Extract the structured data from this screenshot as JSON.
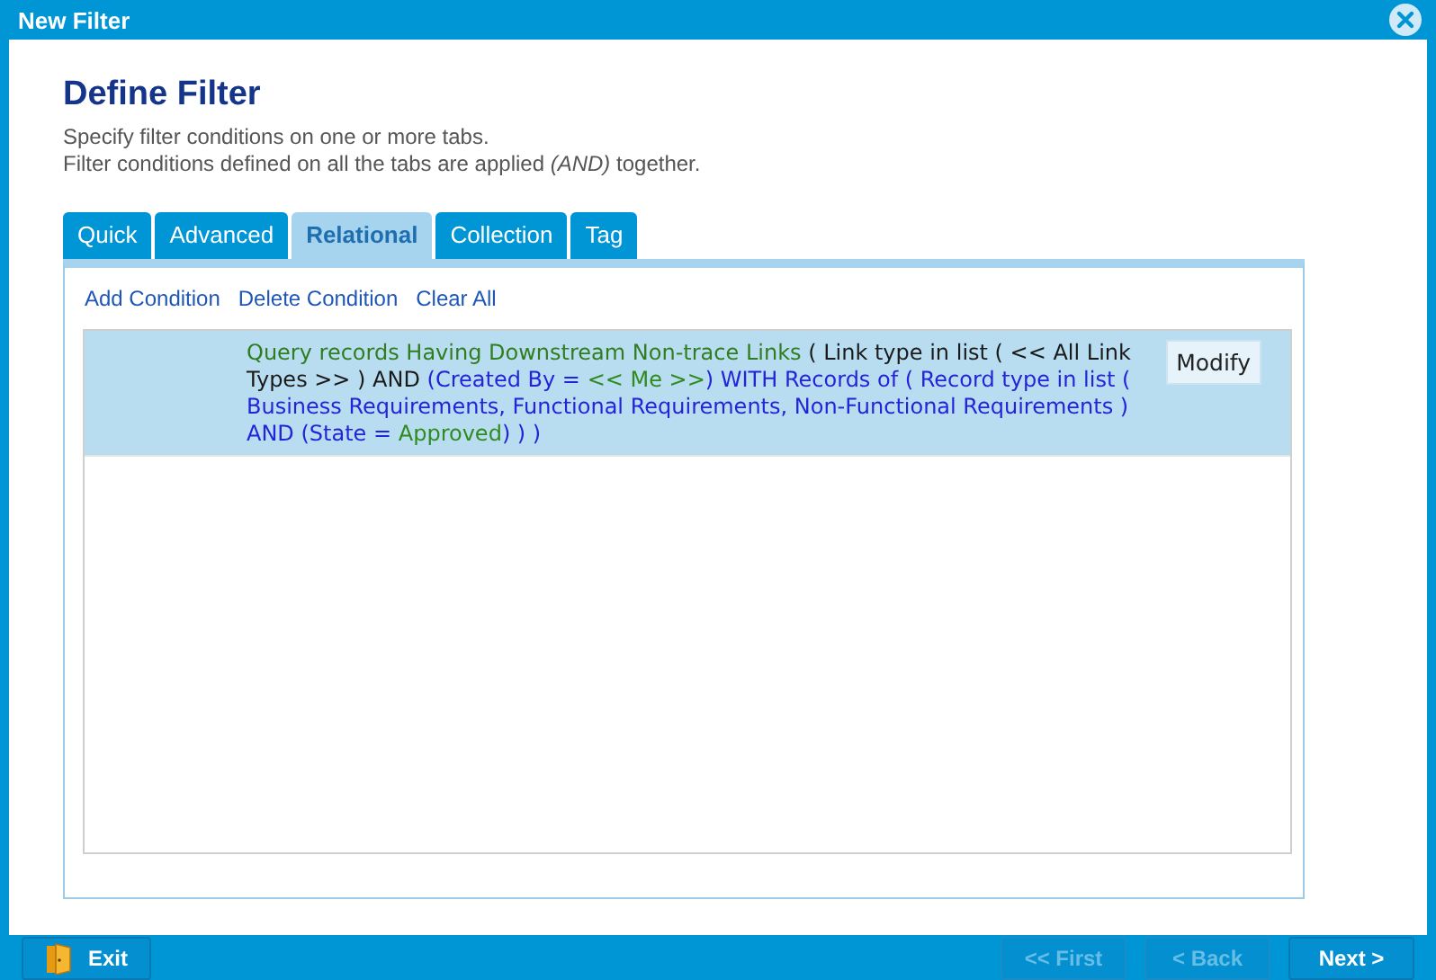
{
  "window": {
    "title": "New Filter"
  },
  "heading": "Define Filter",
  "description": [
    "Specify filter conditions on one or more tabs.",
    "Filter conditions defined on all the tabs are applied *(AND)* together."
  ],
  "tabs": [
    {
      "label": "Quick",
      "selected": false
    },
    {
      "label": "Advanced",
      "selected": false
    },
    {
      "label": "Relational",
      "selected": true
    },
    {
      "label": "Collection",
      "selected": false
    },
    {
      "label": "Tag",
      "selected": false
    }
  ],
  "actions": [
    "Add Condition",
    "Delete Condition",
    "Clear All"
  ],
  "conditions": [
    {
      "selected": true,
      "modify_button": "Modify",
      "segments": [
        {
          "kind": "subject",
          "text": "Query records Having Downstream Non-trace Links"
        },
        {
          "kind": "plain",
          "text": " ( Link type in list ( << All Link Types >> ) AND "
        },
        {
          "kind": "criteria",
          "text": "(Created By = "
        },
        {
          "kind": "value",
          "text": "<< Me >>"
        },
        {
          "kind": "criteria",
          "text": ") WITH Records of ( Record type in list ( Business Requirements, Functional Requirements, Non-Functional Requirements ) AND (State = "
        },
        {
          "kind": "value",
          "text": "Approved"
        },
        {
          "kind": "criteria",
          "text": ") ) )"
        }
      ]
    }
  ],
  "footer_buttons": [
    {
      "kind": "exit",
      "label": "Exit",
      "disabled": false
    },
    {
      "kind": "nav",
      "label": "<< First",
      "disabled": true
    },
    {
      "kind": "nav",
      "label": "< Back",
      "disabled": true
    },
    {
      "kind": "nav",
      "label": "Next >",
      "disabled": false
    }
  ]
}
